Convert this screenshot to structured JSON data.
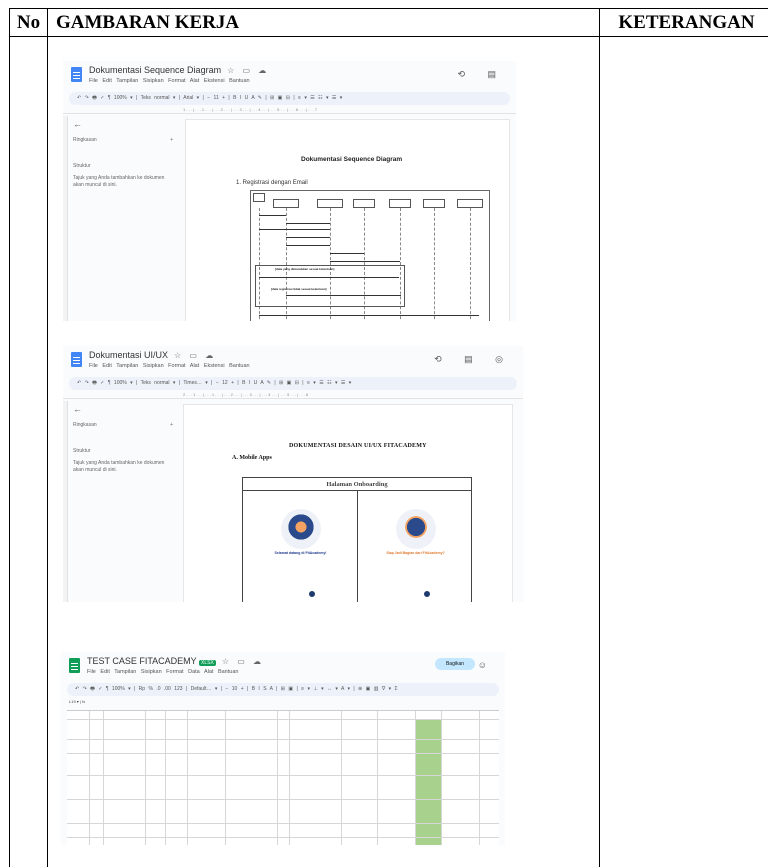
{
  "table": {
    "headers": {
      "no": "No",
      "gambaran": "GAMBARAN KERJA",
      "keterangan": "KETERANGAN"
    }
  },
  "shot1": {
    "doc_title": "Dokumentasi Sequence Diagram",
    "menus": "File  Edit  Tampilan  Sisipkan  Format  Alat  Ekstensi  Bantuan",
    "toolbar": "↶ ↷ 🖶 ✓ ¶ 100% ▾  | Teks normal ▾ | Arial ▾ | − 11 + | B I U A ✎ | ⊞ ▣ ⊟ | ≡ ▾ ☰ ☷ ▾ ☰ ▾",
    "ruler": "1 . . . | . . . 1 . . . | . . . 2 . . . | . . . 3 . . . | . . . 4 . . . | . . . 5 . . . | . . . 6 . . . | . . . 7",
    "sidebar_ringkasan": "Ringkasan",
    "sidebar_struktur": "Struktur",
    "sidebar_hint": "Tajuk yang Anda tambahkan ke dokumen akan muncul di sini.",
    "page_title": "Dokumentasi Sequence Diagram",
    "item": "1.  Registrasi dengan Email"
  },
  "shot2": {
    "doc_title": "Dokumentasi UI/UX",
    "menus": "File  Edit  Tampilan  Sisipkan  Format  Alat  Ekstensi  Bantuan",
    "toolbar": "↶ ↷ 🖶 ✓ ¶ 100% ▾  | Teks normal ▾ | Times… ▾ | − 12 + | B I U A ✎ | ⊞ ▣ ⊟ | ≡ ▾ ☰ ☷ ▾ ☰ ▾",
    "ruler": "2 . . . 1 . . . | . . . 1 . . . | . . . 2 . . . | . . . 3 . . . | . . . 4 . . . | . . . 5 . . . | . . . 6",
    "sidebar_ringkasan": "Ringkasan",
    "sidebar_struktur": "Struktur",
    "sidebar_hint": "Tajuk yang Anda tambahkan ke dokumen akan muncul di sini.",
    "page_title": "DOKUMENTASI DESAIN UI/UX FITACADEMY",
    "section": "A.  Mobile Apps",
    "onboarding_title": "Halaman Onboarding",
    "phone1_caption": "Selamat datang di FitAcademy!",
    "phone2_caption": "Siap Jadi Bagian dari FitAcademy?"
  },
  "shot3": {
    "doc_title": "TEST CASE FITACADEMY",
    "badge": "XLSX",
    "menus": "File  Edit  Tampilan  Sisipkan  Format  Data  Alat  Bantuan",
    "toolbar": "↶ ↷ 🖶 ✓ ¶  100% ▾ | Rp % .0 .00 123 | Default… ▾ | − 10 + | B I S A | ⊞ ▣ | ≡ ▾ ⊥ ▾ ↔ ▾ A ▾ | ⊕ ▣ ▥ ∇ ▾ Σ",
    "share": "Bagikan",
    "cell_ref": "L19",
    "fx": "fx"
  }
}
